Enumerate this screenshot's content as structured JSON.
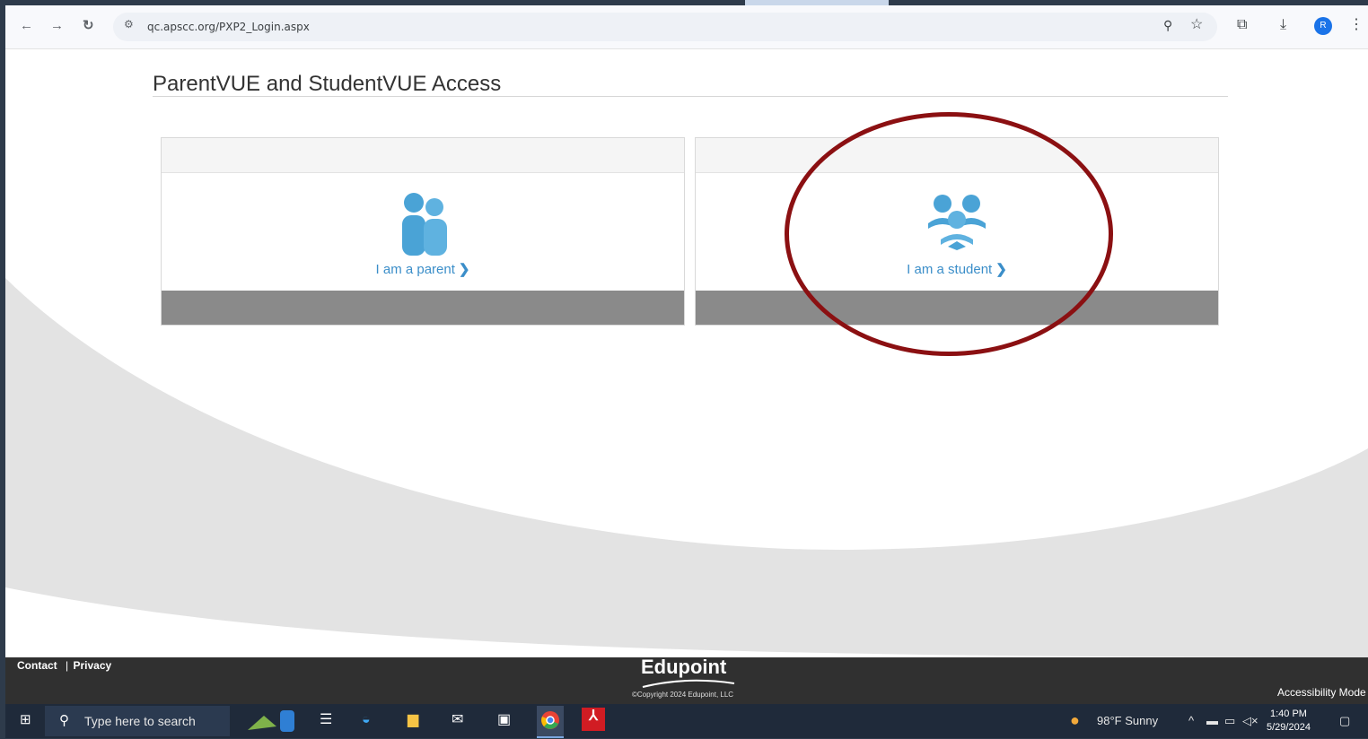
{
  "browser": {
    "url": "qc.apscc.org/PXP2_Login.aspx",
    "profile_initial": "R"
  },
  "page": {
    "title": "ParentVUE and StudentVUE Access",
    "cards": [
      {
        "label": "I am a parent",
        "chevron": "❯"
      },
      {
        "label": "I am a student",
        "chevron": "❯"
      }
    ]
  },
  "footer": {
    "contact": "Contact",
    "separator": "|",
    "privacy": "Privacy",
    "brand": "Edupoint",
    "copyright": "©Copyright 2024 Edupoint, LLC",
    "accessibility": "Accessibility Mode"
  },
  "taskbar": {
    "search_placeholder": "Type here to search",
    "weather": "98°F  Sunny",
    "time": "1:40 PM",
    "date": "5/29/2024"
  },
  "colors": {
    "link": "#3b8ec9",
    "icon": "#4aa3d6",
    "highlight": "#8b1012",
    "footer": "#303030"
  }
}
